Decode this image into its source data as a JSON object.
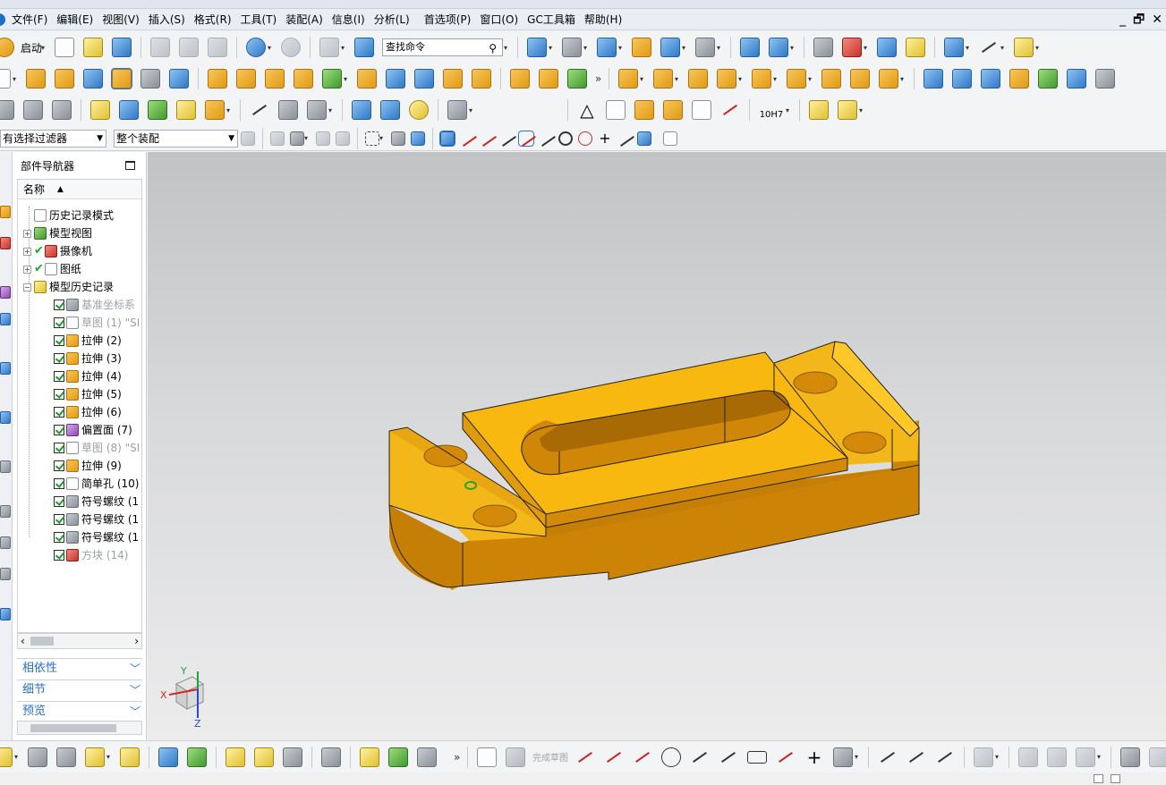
{
  "menubar": {
    "items": [
      "文件(F)",
      "编辑(E)",
      "视图(V)",
      "插入(S)",
      "格式(R)",
      "工具(T)",
      "装配(A)",
      "信息(I)",
      "分析(L)",
      "首选项(P)",
      "窗口(O)",
      "GC工具箱",
      "帮助(H)"
    ],
    "window_controls": {
      "minimize": "_",
      "restore": "🗗",
      "close": "✕"
    }
  },
  "toolbar1": {
    "start_label": "启动",
    "search": {
      "value": "查找命令",
      "icon": "search-icon"
    }
  },
  "toolbar2": {
    "more_glyph": "»"
  },
  "toolbar4": {
    "selection_filter": "有选择过滤器",
    "assembly_scope": "整个装配"
  },
  "toolbar3": {
    "tolerance_label": "10H7"
  },
  "navigator": {
    "title": "部件导航器",
    "column_name": "名称",
    "sort_glyph": "▲",
    "items": [
      {
        "label": "历史记录模式",
        "icon": "clock-icon",
        "level": 0,
        "expander": "",
        "check": "none",
        "dim": false
      },
      {
        "label": "模型视图",
        "icon": "model-view-icon",
        "level": 0,
        "expander": "+",
        "check": "none",
        "dim": false
      },
      {
        "label": "摄像机",
        "icon": "camera-icon",
        "level": 0,
        "expander": "+",
        "check": "green",
        "dim": false
      },
      {
        "label": "图纸",
        "icon": "drawing-icon",
        "level": 0,
        "expander": "+",
        "check": "green",
        "dim": false
      },
      {
        "label": "模型历史记录",
        "icon": "folder-icon",
        "level": 0,
        "expander": "−",
        "check": "none",
        "dim": false
      },
      {
        "label": "基准坐标系",
        "icon": "datum-csys-icon",
        "level": 1,
        "expander": "",
        "check": "box",
        "dim": true
      },
      {
        "label": "草图 (1) \"SI",
        "icon": "sketch-icon",
        "level": 1,
        "expander": "",
        "check": "box",
        "dim": true
      },
      {
        "label": "拉伸 (2)",
        "icon": "extrude-icon",
        "level": 1,
        "expander": "",
        "check": "box",
        "dim": false
      },
      {
        "label": "拉伸 (3)",
        "icon": "extrude-icon",
        "level": 1,
        "expander": "",
        "check": "box",
        "dim": false
      },
      {
        "label": "拉伸 (4)",
        "icon": "extrude-icon",
        "level": 1,
        "expander": "",
        "check": "box",
        "dim": false
      },
      {
        "label": "拉伸 (5)",
        "icon": "extrude-icon",
        "level": 1,
        "expander": "",
        "check": "box",
        "dim": false
      },
      {
        "label": "拉伸 (6)",
        "icon": "extrude-icon",
        "level": 1,
        "expander": "",
        "check": "box",
        "dim": false
      },
      {
        "label": "偏置面 (7)",
        "icon": "offset-face-icon",
        "level": 1,
        "expander": "",
        "check": "box",
        "dim": false
      },
      {
        "label": "草图 (8) \"SI",
        "icon": "sketch-icon",
        "level": 1,
        "expander": "",
        "check": "box",
        "dim": true
      },
      {
        "label": "拉伸 (9)",
        "icon": "extrude-icon",
        "level": 1,
        "expander": "",
        "check": "box",
        "dim": false
      },
      {
        "label": "简单孔 (10)",
        "icon": "hole-icon",
        "level": 1,
        "expander": "",
        "check": "box",
        "dim": false
      },
      {
        "label": "符号螺纹 (1",
        "icon": "thread-icon",
        "level": 1,
        "expander": "",
        "check": "box",
        "dim": false
      },
      {
        "label": "符号螺纹 (1",
        "icon": "thread-icon",
        "level": 1,
        "expander": "",
        "check": "box",
        "dim": false
      },
      {
        "label": "符号螺纹 (1",
        "icon": "thread-icon",
        "level": 1,
        "expander": "",
        "check": "box",
        "dim": false
      },
      {
        "label": "方块 (14)",
        "icon": "block-icon",
        "level": 1,
        "expander": "",
        "check": "box",
        "dim": true
      }
    ],
    "panels": [
      "相依性",
      "细节",
      "预览"
    ],
    "panel_chevron": "﹀"
  },
  "viewport": {
    "triad": {
      "x_label": "X",
      "y_label": "Y",
      "z_label": "Z"
    },
    "model_color": "#f2b417"
  },
  "bottom_toolbar": {
    "finish_sketch_label": "完成草图",
    "more_glyph": "»"
  },
  "colors": {
    "accent": "#2a6fc0",
    "menubar_bg": "#e9eef5",
    "viewport_top": "#c2c3c5",
    "viewport_bottom": "#ececed"
  }
}
